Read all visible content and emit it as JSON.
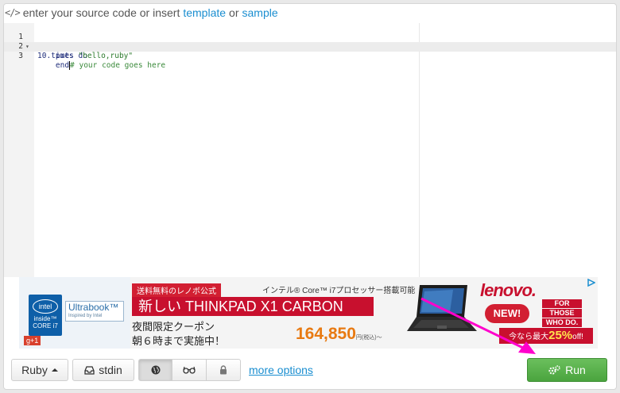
{
  "header": {
    "icon": "code-icon",
    "text_before": "enter your source code or insert",
    "template_link": "template",
    "or_text": "or",
    "sample_link": "sample"
  },
  "editor": {
    "lines": [
      {
        "number": "1",
        "code": "10.times do"
      },
      {
        "number": "2",
        "code_prefix": "    puts ",
        "string": "\"hello,ruby\""
      },
      {
        "number": "3",
        "code_prefix": "    end",
        "comment": "# your code goes here"
      }
    ]
  },
  "ad": {
    "intel_logo": "intel",
    "intel_inside": "inside™",
    "intel_core": "CORE i7",
    "ultrabook_title": "Ultrabook™",
    "ultrabook_sub": "Inspired by Intel",
    "gplus": "g+1",
    "ribbon_small": "送料無料のレノボ公式",
    "top_line": "インテル® Core™ i7プロセッサー搭載可能",
    "ribbon_big": "新しい THINKPAD X1 CARBON",
    "coupon_line1": "夜間限定クーポン",
    "coupon_line2": "朝６時まで実施中！",
    "price": "164,850",
    "price_suffix": "円(税込)～",
    "brand": "lenovo.",
    "new_badge": "NEW!",
    "for_those": [
      "FOR",
      "THOSE",
      "WHO DO."
    ],
    "discount_prefix": "今なら最大",
    "discount_value": "25%",
    "discount_suffix": "off!",
    "adchoices_icon": "adchoices-icon"
  },
  "toolbar": {
    "language_label": "Ruby",
    "stdin_label": "stdin",
    "more_options": "more options",
    "run_label": "Run"
  },
  "colors": {
    "link": "#1a8ed0",
    "run_green": "#4aa43e",
    "ad_red": "#c8102e",
    "annotation_arrow": "#ff00cc"
  }
}
